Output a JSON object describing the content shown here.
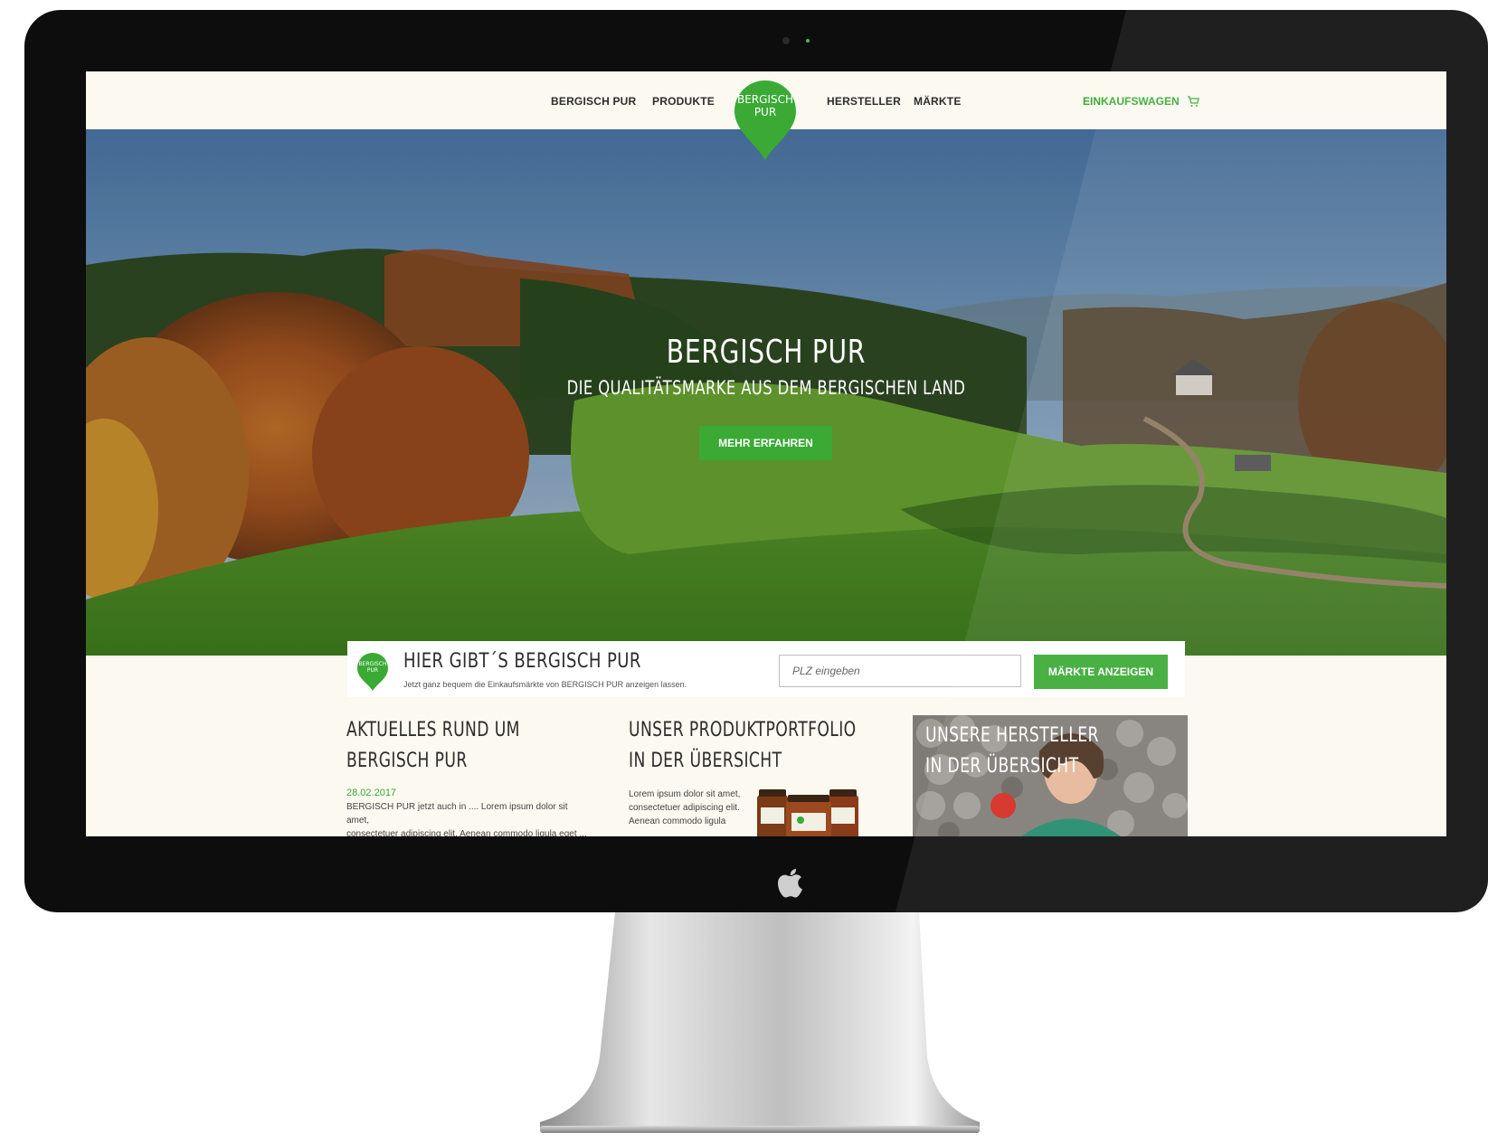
{
  "nav": {
    "left_items": [
      {
        "label": "BERGISCH PUR"
      },
      {
        "label": "PRODUKTE"
      }
    ],
    "right_items": [
      {
        "label": "HERSTELLER"
      },
      {
        "label": "MÄRKTE"
      }
    ],
    "logo_line1": "BERGISCH",
    "logo_line2": "PUR",
    "cart_label": "EINKAUFSWAGEN",
    "cart_icon": "shopping-cart-icon"
  },
  "hero": {
    "title": "BERGISCH PUR",
    "subtitle": "DIE QUALITÄTSMARKE AUS DEM BERGISCHEN LAND",
    "button_label": "MEHR ERFAHREN"
  },
  "finder": {
    "badge_line1": "BERGISCH",
    "badge_line2": "PUR",
    "title": "HIER GIBT´S BERGISCH PUR",
    "subtitle": "Jetzt ganz bequem die Einkaufsmärkte von BERGISCH PUR anzeigen lassen.",
    "input_placeholder": "PLZ eingeben",
    "button_label": "MÄRKTE ANZEIGEN"
  },
  "cards": {
    "news": {
      "title_line1": "AKTUELLES RUND UM",
      "title_line2": "BERGISCH PUR",
      "date": "28.02.2017",
      "text_line1": "BERGISCH PUR jetzt auch in .... Lorem ipsum dolor sit amet,",
      "text_line2": "consectetuer adipiscing elit. Aenean commodo ligula eget ..."
    },
    "portfolio": {
      "title_line1": "UNSER PRODUKTPORTFOLIO",
      "title_line2": "IN DER ÜBERSICHT",
      "text_line1": "Lorem ipsum dolor sit amet,",
      "text_line2": "consectetuer adipiscing elit.",
      "text_line3": "Aenean commodo ligula"
    },
    "producers": {
      "title_line1": "UNSERE HERSTELLER",
      "title_line2": "IN DER ÜBERSICHT"
    }
  },
  "colors": {
    "brand_green": "#3aaa35",
    "page_bg": "#fbf9f0",
    "text_dark": "#2d2d2d"
  }
}
